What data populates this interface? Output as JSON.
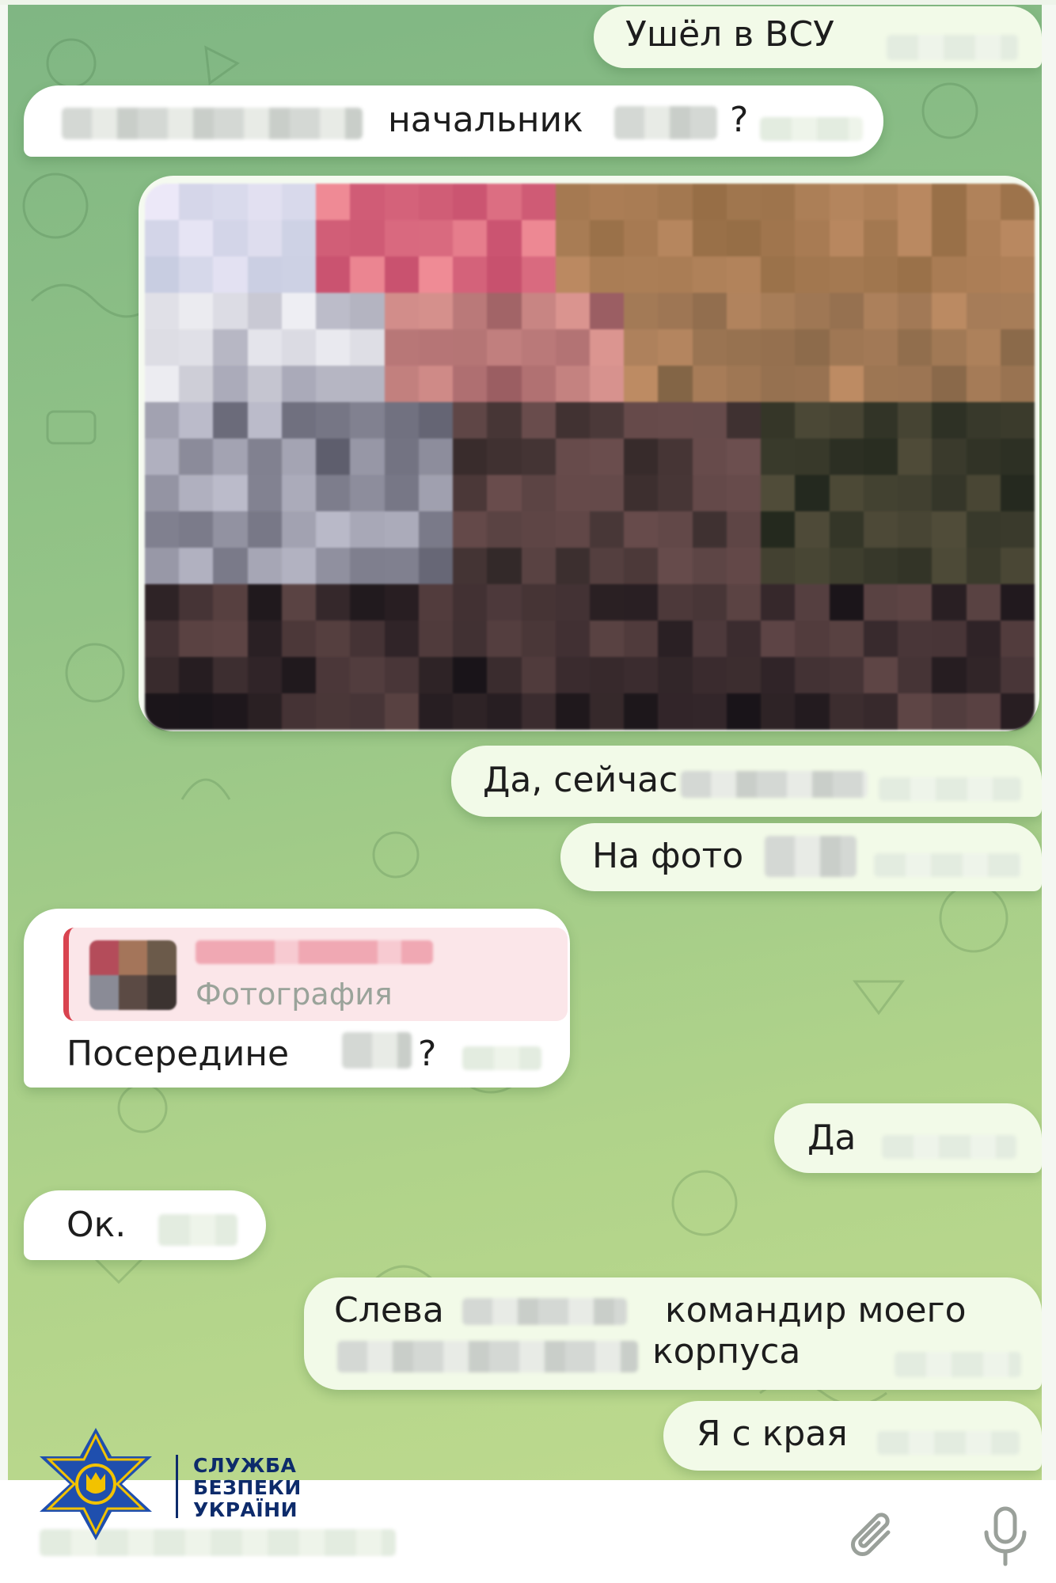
{
  "messages": [
    {
      "id": "m1",
      "direction": "outgoing",
      "text": "Ушёл в ВСУ"
    },
    {
      "id": "m2",
      "direction": "incoming",
      "text_visible": "начальник",
      "text_end": "?"
    },
    {
      "id": "m3",
      "direction": "outgoing",
      "type": "photo"
    },
    {
      "id": "m4",
      "direction": "outgoing",
      "text": "Да, сейчас"
    },
    {
      "id": "m5",
      "direction": "outgoing",
      "text": "На фото"
    },
    {
      "id": "m6",
      "direction": "incoming",
      "reply_label": "Фотография",
      "text": "Посередине",
      "text_end": "?"
    },
    {
      "id": "m7",
      "direction": "outgoing",
      "text": "Да"
    },
    {
      "id": "m8",
      "direction": "incoming",
      "text": "Ок."
    },
    {
      "id": "m9",
      "direction": "outgoing",
      "line1_start": "Слева",
      "line1_end": "командир моего",
      "line2_end": "корпуса"
    },
    {
      "id": "m10",
      "direction": "outgoing",
      "text": "Я с края"
    }
  ],
  "composer": {
    "attach_icon": "paperclip-icon",
    "mic_icon": "microphone-icon"
  },
  "watermark": {
    "line1": "СЛУЖБА",
    "line2": "БЕЗПЕКИ",
    "line3": "УКРАЇНИ",
    "colors": {
      "shield_blue": "#1f4fae",
      "shield_yellow": "#f2c200",
      "text": "#0d2b6b"
    }
  },
  "colors": {
    "chat_bg_top": "#7fb683",
    "chat_bg_bottom": "#c2dc8f",
    "bubble_out": "#f2fae8",
    "bubble_in": "#ffffff",
    "reply_accent": "#d9434f"
  }
}
